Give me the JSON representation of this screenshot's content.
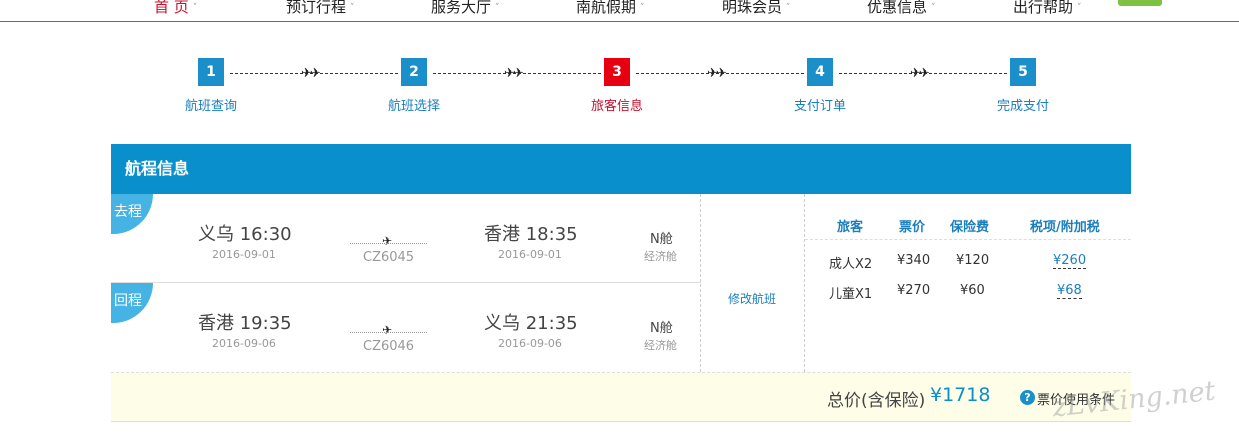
{
  "nav": {
    "items": [
      {
        "label": "首 页",
        "active": true
      },
      {
        "label": "预订行程",
        "active": false
      },
      {
        "label": "服务大厅",
        "active": false
      },
      {
        "label": "南航假期",
        "active": false
      },
      {
        "label": "明珠会员",
        "active": false
      },
      {
        "label": "优惠信息",
        "active": false
      },
      {
        "label": "出行帮助",
        "active": false
      }
    ],
    "chevron": "˅"
  },
  "steps": [
    {
      "num": "1",
      "label": "航班查询",
      "active": false
    },
    {
      "num": "2",
      "label": "航班选择",
      "active": false
    },
    {
      "num": "3",
      "label": "旅客信息",
      "active": true
    },
    {
      "num": "4",
      "label": "支付订单",
      "active": false
    },
    {
      "num": "5",
      "label": "完成支付",
      "active": false
    }
  ],
  "itinerary": {
    "title": "航程信息",
    "legs": [
      {
        "tag": "去程",
        "dep_city_time": "义乌  16:30",
        "dep_date": "2016-09-01",
        "flight_no": "CZ6045",
        "arr_city_time": "香港  18:35",
        "arr_date": "2016-09-01",
        "cabin": "N舱",
        "cabin_class": "经济舱"
      },
      {
        "tag": "回程",
        "dep_city_time": "香港  19:35",
        "dep_date": "2016-09-06",
        "flight_no": "CZ6046",
        "arr_city_time": "义乌  21:35",
        "arr_date": "2016-09-06",
        "cabin": "N舱",
        "cabin_class": "经济舱"
      }
    ],
    "modify_label": "修改航班",
    "price_table": {
      "headers": [
        "旅客",
        "票价",
        "保险费",
        "税项/附加税"
      ],
      "rows": [
        {
          "passenger": "成人X2",
          "fare": "¥340",
          "insurance": "¥120",
          "tax": "¥260"
        },
        {
          "passenger": "儿童X1",
          "fare": "¥270",
          "insurance": "¥60",
          "tax": "¥68"
        }
      ]
    },
    "total_label": "总价(含保险)",
    "total_value": "¥1718",
    "rules_label": "票价使用条件",
    "help_icon": "question-icon"
  },
  "watermark": "zLvKing.net",
  "colors": {
    "accent_blue": "#0a8fcd",
    "active_red": "#e60012",
    "total_bg": "#fdfde8"
  }
}
